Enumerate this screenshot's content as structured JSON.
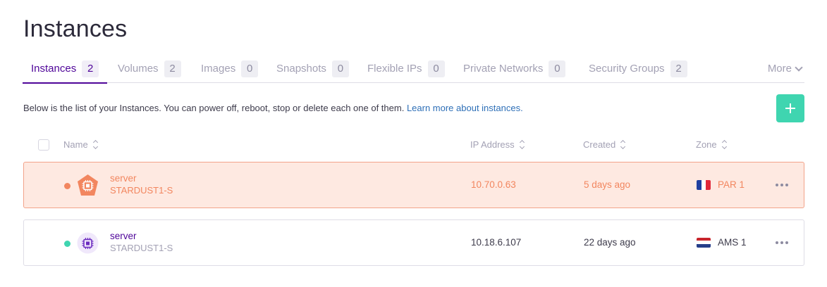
{
  "page": {
    "title": "Instances"
  },
  "tabs": [
    {
      "label": "Instances",
      "count": "2",
      "active": true
    },
    {
      "label": "Volumes",
      "count": "2"
    },
    {
      "label": "Images",
      "count": "0"
    },
    {
      "label": "Snapshots",
      "count": "0"
    },
    {
      "label": "Flexible IPs",
      "count": "0"
    },
    {
      "label": "Private Networks",
      "count": "0"
    },
    {
      "label": "Security Groups",
      "count": "2"
    }
  ],
  "more_label": "More",
  "description": {
    "text": "Below is the list of your Instances. You can power off, reboot, stop or delete each one of them.",
    "link": "Learn more about instances."
  },
  "add_button": {
    "icon": "plus-icon",
    "color": "#3fd5b0"
  },
  "table": {
    "columns": [
      "Name",
      "IP Address",
      "Created",
      "Zone"
    ],
    "rows": [
      {
        "name": "server",
        "type": "STARDUST1-S",
        "ip": "10.70.0.63",
        "created": "5 days ago",
        "zone": "PAR 1",
        "flag": "france-flag-icon",
        "status_color": "#f2865f",
        "selected": true
      },
      {
        "name": "server",
        "type": "STARDUST1-S",
        "ip": "10.18.6.107",
        "created": "22 days ago",
        "zone": "AMS 1",
        "flag": "netherlands-flag-icon",
        "status_color": "#3fd5b0",
        "selected": false
      }
    ]
  },
  "colors": {
    "accent": "#4f0599",
    "selected_row_bg": "#fee9e1",
    "selected_row_text": "#f2865f",
    "link": "#2e6fb7"
  }
}
